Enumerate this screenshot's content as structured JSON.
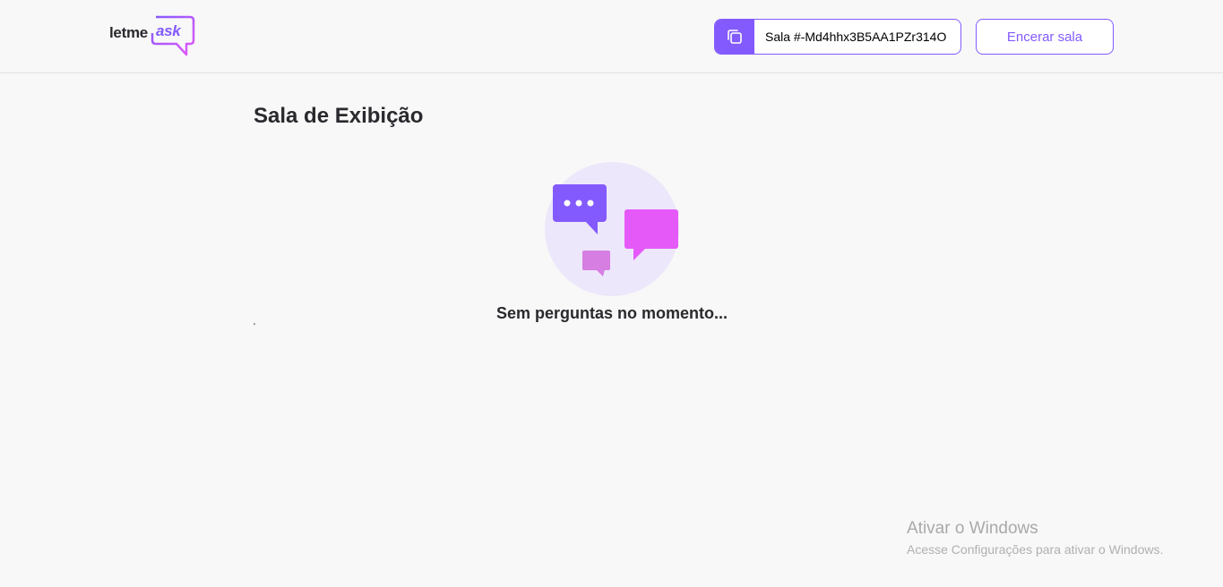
{
  "header": {
    "logo": {
      "part1": "letme",
      "part2": "ask"
    },
    "room_code": {
      "label": "Sala #-Md4hhx3B5AA1PZr314O"
    },
    "close_room_label": "Encerar sala"
  },
  "main": {
    "title": "Sala de Exibição",
    "empty_state": "Sem perguntas no momento...",
    "stray_mark": "'"
  },
  "windows_watermark": {
    "title": "Ativar o Windows",
    "subtitle": "Acesse Configurações para ativar o Windows."
  },
  "colors": {
    "accent": "#835afd",
    "pink": "#e559f9",
    "background": "#f8f8f8"
  }
}
